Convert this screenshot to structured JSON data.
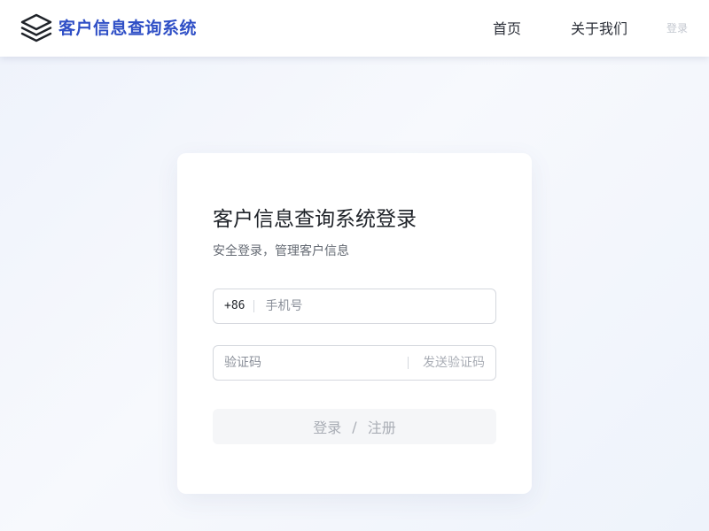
{
  "header": {
    "brand": "客户信息查询系统",
    "nav": [
      {
        "label": "首页"
      },
      {
        "label": "关于我们"
      }
    ],
    "login_link": "登录"
  },
  "card": {
    "title": "客户信息查询系统登录",
    "subtitle": "安全登录，管理客户信息",
    "phone": {
      "country_code": "+86",
      "placeholder": "手机号",
      "value": ""
    },
    "code": {
      "placeholder": "验证码",
      "value": "",
      "send_label": "发送验证码"
    },
    "submit": {
      "login_label": "登录",
      "separator": "/",
      "register_label": "注册"
    }
  },
  "colors": {
    "brand": "#2f4fc6",
    "text_primary": "#1f2329",
    "text_secondary": "#646a73",
    "disabled_text": "#a9adb5",
    "border": "#d5d8de"
  },
  "icons": {
    "logo": "stacked-layers-icon"
  }
}
